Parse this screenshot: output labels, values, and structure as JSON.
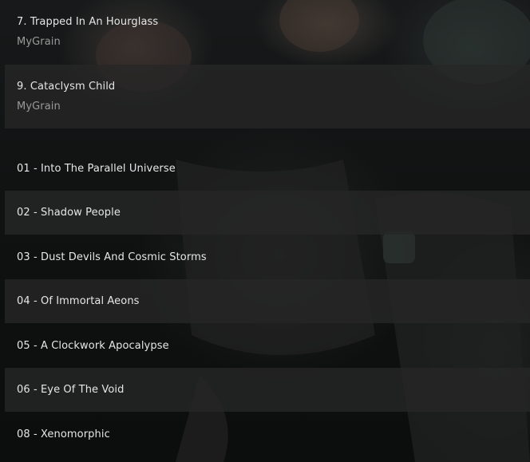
{
  "queue": {
    "items": [
      {
        "title": "7. Trapped In An Hourglass",
        "artist": "MyGrain"
      },
      {
        "title": "9. Cataclysm Child",
        "artist": "MyGrain"
      }
    ]
  },
  "tracks": [
    "01 - Into The Parallel Universe",
    "02 - Shadow People",
    "03 - Dust Devils And Cosmic Storms",
    "04 - Of Immortal Aeons",
    "05 - A Clockwork Apocalypse",
    "06 - Eye Of The Void",
    "08 - Xenomorphic"
  ]
}
